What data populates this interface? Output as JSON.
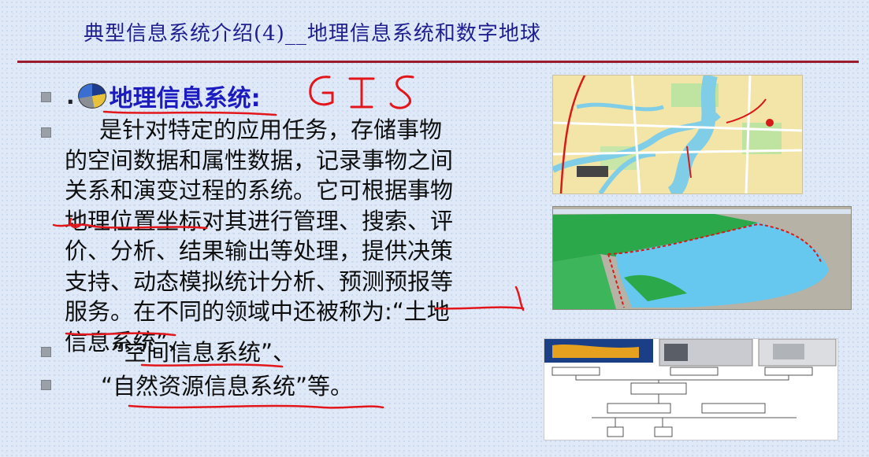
{
  "slide": {
    "title": "典型信息系统介绍(4)__地理信息系统和数字地球",
    "heading": {
      "dot": ".",
      "text": "地理信息系统:"
    },
    "body_lines": [
      "是针对特定的应用任务，存储事物",
      "的空间数据和属性数据，记录事物之间",
      "关系和演变过程的系统。它可根据事物",
      "地理位置坐标对其进行管理、搜索、评",
      "价、分析、结果输出等处理，提供决策",
      "支持、动态模拟统计分析、预测预报等",
      "服务。在不同的领域中还被称为:“土地",
      "信息系统”、"
    ],
    "item_spatial": "“空间信息系统”、",
    "item_natural": "“自然资源信息系统”等。",
    "handwritten_note": "GIS"
  },
  "colors": {
    "title": "#1f1f8f",
    "rule": "#9b1b2d",
    "heading": "#1b1bbf",
    "ink": "#e3161b"
  },
  "icons": {
    "heading_bullet": "globe-pie-icon"
  }
}
